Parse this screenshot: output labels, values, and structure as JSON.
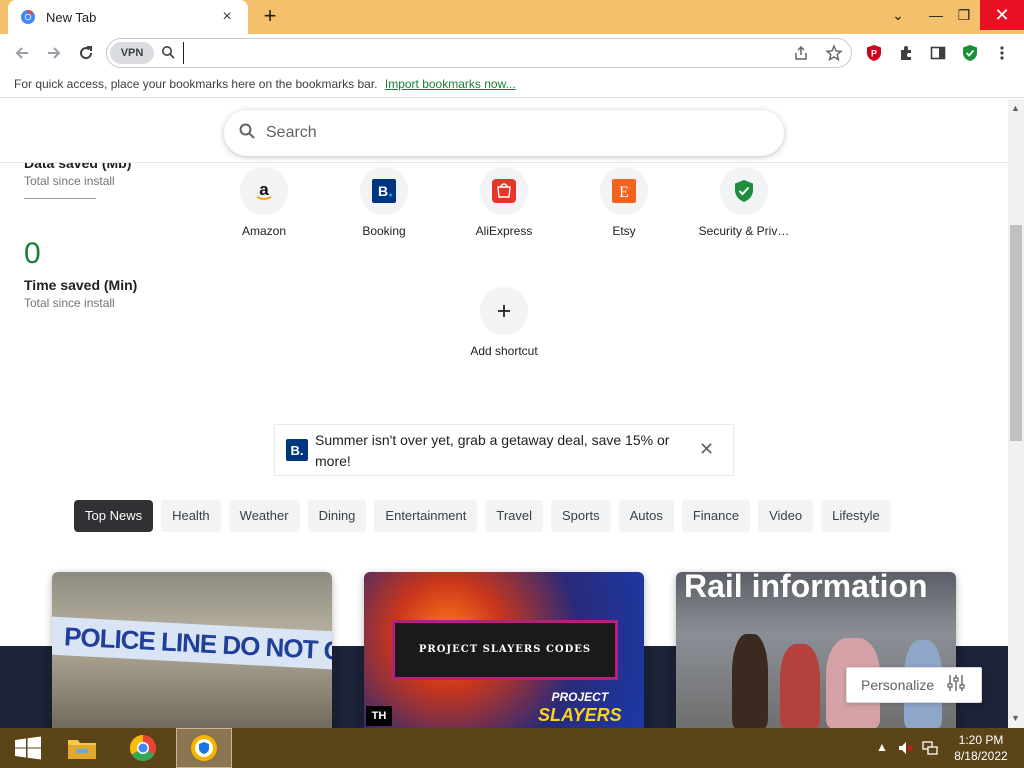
{
  "browser": {
    "tab_title": "New Tab",
    "tab_close": "×",
    "new_tab": "+",
    "window_controls": {
      "dropdown": "⌄",
      "minimize": "—",
      "restore": "❐",
      "close": "✕"
    }
  },
  "toolbar": {
    "vpn_label": "VPN",
    "omnibox_value": "",
    "extensions": [
      "proton-pass-icon",
      "puzzle-icon",
      "side-panel-icon",
      "shield-check-icon",
      "menu-icon"
    ]
  },
  "bookmarks_bar": {
    "text": "For quick access, place your bookmarks here on the bookmarks bar.",
    "import_link": "Import bookmarks now..."
  },
  "search": {
    "placeholder": "Search"
  },
  "stats": {
    "data_saved_title": "Data saved (Mb)",
    "data_saved_sub": "Total since install",
    "time_saved_value": "0",
    "time_saved_title": "Time saved (Min)",
    "time_saved_sub": "Total since install"
  },
  "shortcuts": [
    {
      "label": "Amazon",
      "icon": "amazon-icon"
    },
    {
      "label": "Booking",
      "icon": "booking-icon"
    },
    {
      "label": "AliExpress",
      "icon": "aliexpress-icon"
    },
    {
      "label": "Etsy",
      "icon": "etsy-icon"
    },
    {
      "label": "Security & Priv…",
      "icon": "shield-icon"
    },
    {
      "label": "Add shortcut",
      "icon": "plus-icon"
    }
  ],
  "promo": {
    "logo": "B.",
    "text": "Summer isn't over yet, grab a getaway deal, save 15% or more!",
    "close": "✕"
  },
  "news_categories": [
    "Top News",
    "Health",
    "Weather",
    "Dining",
    "Entertainment",
    "Travel",
    "Sports",
    "Autos",
    "Finance",
    "Video",
    "Lifestyle"
  ],
  "news_cards": {
    "card1_text": "POLICE LINE DO NOT CROSS",
    "card2_title": "PROJECT SLAYERS CODES",
    "card2_logo_line1": "PROJECT",
    "card2_logo_line2": "SLAYERS",
    "card2_badge": "TH",
    "card3_text": "Rail information"
  },
  "personalize": {
    "label": "Personalize"
  },
  "taskbar": {
    "time": "1:20 PM",
    "date": "8/18/2022"
  },
  "colors": {
    "tabstrip": "#f4c06b",
    "accent_green": "#188038",
    "chip_active": "#303134",
    "taskbar": "#5b4518"
  }
}
